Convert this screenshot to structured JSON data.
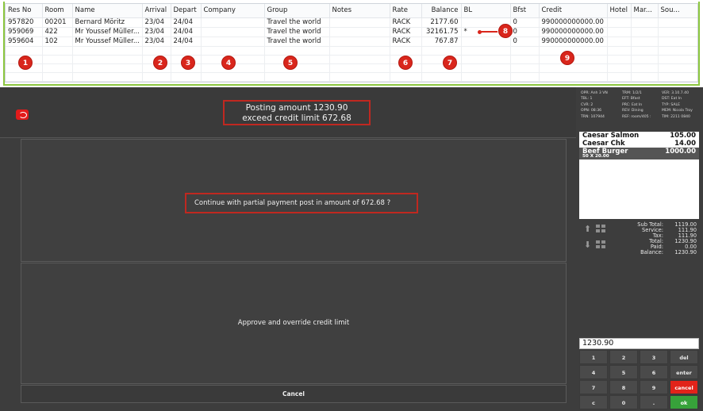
{
  "grid": {
    "columns": [
      "Res No",
      "Room",
      "Name",
      "Arrival",
      "Depart",
      "Company",
      "Group",
      "Notes",
      "Rate",
      "Balance",
      "BL",
      "Bfst",
      "Credit",
      "Hotel",
      "Mar...",
      "Sou..."
    ],
    "rows": [
      {
        "res_no": "957820",
        "room": "00201",
        "name": "Bernard Möritz",
        "arrival": "23/04",
        "depart": "24/04",
        "company": "",
        "group": "Travel the world",
        "notes": "",
        "rate": "RACK",
        "balance": "2177.60",
        "bl": "",
        "bfst": "0",
        "credit": "990000000000.00",
        "hotel": "",
        "mar": "",
        "sou": ""
      },
      {
        "res_no": "959069",
        "room": "422",
        "name": "Mr Youssef Müller...",
        "arrival": "23/04",
        "depart": "24/04",
        "company": "",
        "group": "Travel the world",
        "notes": "",
        "rate": "RACK",
        "balance": "32161.75",
        "bl": "*",
        "bfst": "0",
        "credit": "990000000000.00",
        "hotel": "",
        "mar": "",
        "sou": ""
      },
      {
        "res_no": "959604",
        "room": "102",
        "name": "Mr Youssef Müller...",
        "arrival": "23/04",
        "depart": "24/04",
        "company": "",
        "group": "Travel the world",
        "notes": "",
        "rate": "RACK",
        "balance": "767.87",
        "bl": "",
        "bfst": "0",
        "credit": "990000000000.00",
        "hotel": "",
        "mar": "",
        "sou": ""
      }
    ]
  },
  "markers": [
    "1",
    "2",
    "3",
    "4",
    "5",
    "6",
    "7",
    "8",
    "9"
  ],
  "dialog": {
    "posting_line1": "Posting amount 1230.90",
    "posting_line2": "exceed credit limit 672.68",
    "question": "Continue with partial payment post in amount of 672.68 ?",
    "approve_label": "Approve and override credit limit",
    "cancel_label": "Cancel"
  },
  "pos": {
    "info": [
      [
        "OPR: Anh 3 VN",
        "TRM: 1/2/1",
        "VER: 3.10.7.40"
      ],
      [
        "TBL: 1",
        "EFT: Bfast",
        "DST: Eat In"
      ],
      [
        "CVR: 2",
        "PRC: Eat In",
        "TYP: SALE"
      ],
      [
        "OPN: 08:36",
        "REV: Dining",
        "MEM: Nicola Troy"
      ],
      [
        "TRN: 107944",
        "REF: room/405 :",
        "TIM: 2211 0840"
      ]
    ],
    "items": [
      {
        "name": "Caesar Salmon",
        "price": "105.00",
        "sub": ""
      },
      {
        "name": "Caesar Chk",
        "price": "14.00",
        "sub": ""
      },
      {
        "name": "Beef Burger",
        "price": "1000.00",
        "sub": "50 X 20.00"
      }
    ],
    "totals": [
      {
        "label": "Sub Total:",
        "value": "1119.00"
      },
      {
        "label": "Service:",
        "value": "111.90"
      },
      {
        "label": "Tax:",
        "value": "111.90"
      },
      {
        "label": "Total:",
        "value": "1230.90"
      },
      {
        "label": "Paid:",
        "value": "0.00"
      },
      {
        "label": "Balance:",
        "value": "1230.90"
      }
    ],
    "amount": "1230.90",
    "keypad": [
      [
        "1",
        "2",
        "3",
        "del"
      ],
      [
        "4",
        "5",
        "6",
        "enter"
      ],
      [
        "7",
        "8",
        "9",
        "cancel"
      ],
      [
        "c",
        "0",
        ".",
        "ok"
      ]
    ]
  },
  "colors": {
    "accent_red": "#d9261c",
    "ok_green": "#37a23a",
    "grid_border_green": "#8cc63f"
  }
}
